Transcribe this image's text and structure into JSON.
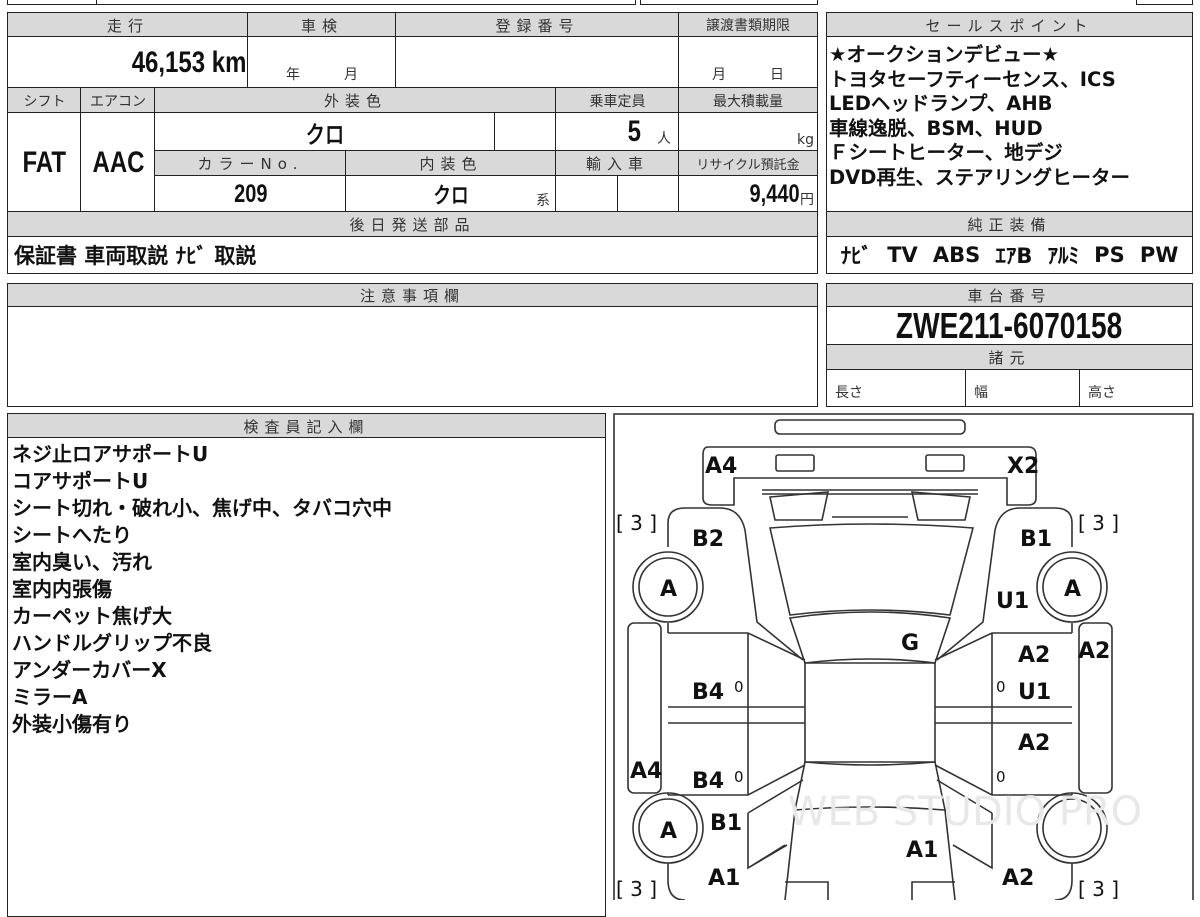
{
  "top": {
    "mileage_h": "走行",
    "mileage": "46,153 km",
    "shaken_h": "車検",
    "shaken_year": "年",
    "shaken_month": "月",
    "reg_h": "登録番号",
    "reg": "",
    "transfer_h": "譲渡書類期限",
    "transfer_month": "月",
    "transfer_day": "日",
    "shift_h": "シフト",
    "shift": "FAT",
    "ac_h": "エアコン",
    "ac": "AAC",
    "ext_color_h": "外装色",
    "ext_color": "クロ",
    "capacity_h": "乗車定員",
    "capacity": "5",
    "capacity_unit": "人",
    "load_h": "最大積載量",
    "load_unit": "kg",
    "color_no_h": "カラーNo.",
    "color_no": "209",
    "int_color_h": "内装色",
    "int_color": "クロ",
    "int_color_suffix": "系",
    "import_h": "輸入車",
    "recycle_h": "リサイクル預託金",
    "recycle": "9,440",
    "recycle_unit": "円",
    "later_parts_h": "後日発送部品",
    "later_parts": "保証書 車両取説 ﾅﾋﾞ 取説"
  },
  "sales": {
    "title": "セールスポイント",
    "lines": [
      "★オークションデビュー★",
      "トヨタセーフティーセンス、ICS",
      "LEDヘッドランプ、AHB",
      "車線逸脱、BSM、HUD",
      "Ｆシートヒーター、地デジ",
      "DVD再生、ステアリングヒーター"
    ]
  },
  "equipment": {
    "title": "純正装備",
    "items": [
      "ﾅﾋﾞ",
      "TV",
      "ABS",
      "ｴｱB",
      "ｱﾙﾐ",
      "PS",
      "PW"
    ]
  },
  "notes": {
    "title": "注意事項欄"
  },
  "chassis": {
    "title": "車台番号",
    "number": "ZWE211-6070158",
    "spec_title": "諸元",
    "length": "長さ",
    "width": "幅",
    "height": "高さ"
  },
  "inspector": {
    "title": "検査員記入欄",
    "lines": [
      "ネジ止ロアサポートU",
      "コアサポートU",
      "シート切れ・破れ小、焦げ中、タバコ穴中",
      "シートへたり",
      "室内臭い、汚れ",
      "室内内張傷",
      "カーペット焦げ大",
      "ハンドルグリップ不良",
      "アンダーカバーX",
      "ミラーA",
      "外装小傷有り"
    ]
  },
  "diagram": {
    "labels": {
      "a4_front": "A4",
      "x2": "X2",
      "b2": "B2",
      "b1_front": "B1",
      "tire_fl": "A",
      "tire_fr": "A",
      "u1_fender": "U1",
      "g": "G",
      "a2_door_f": "A2",
      "a2_side": "A2",
      "b4_f": "B4",
      "u1_door": "U1",
      "a2_door_r": "A2",
      "a4_side": "A4",
      "b4_r": "B4",
      "b1_rear": "B1",
      "tire_rl": "A",
      "a1_trunk": "A1",
      "a1_rear": "A1",
      "a2_rear": "A2",
      "zero1": "0",
      "zero2": "0",
      "zero3": "0",
      "zero4": "0",
      "br1": "[ 3 ]",
      "br2": "[ 3 ]",
      "br3": "[ 3 ]",
      "br4": "[ 3 ]"
    },
    "watermark": "WEB STUDIO PRO"
  }
}
